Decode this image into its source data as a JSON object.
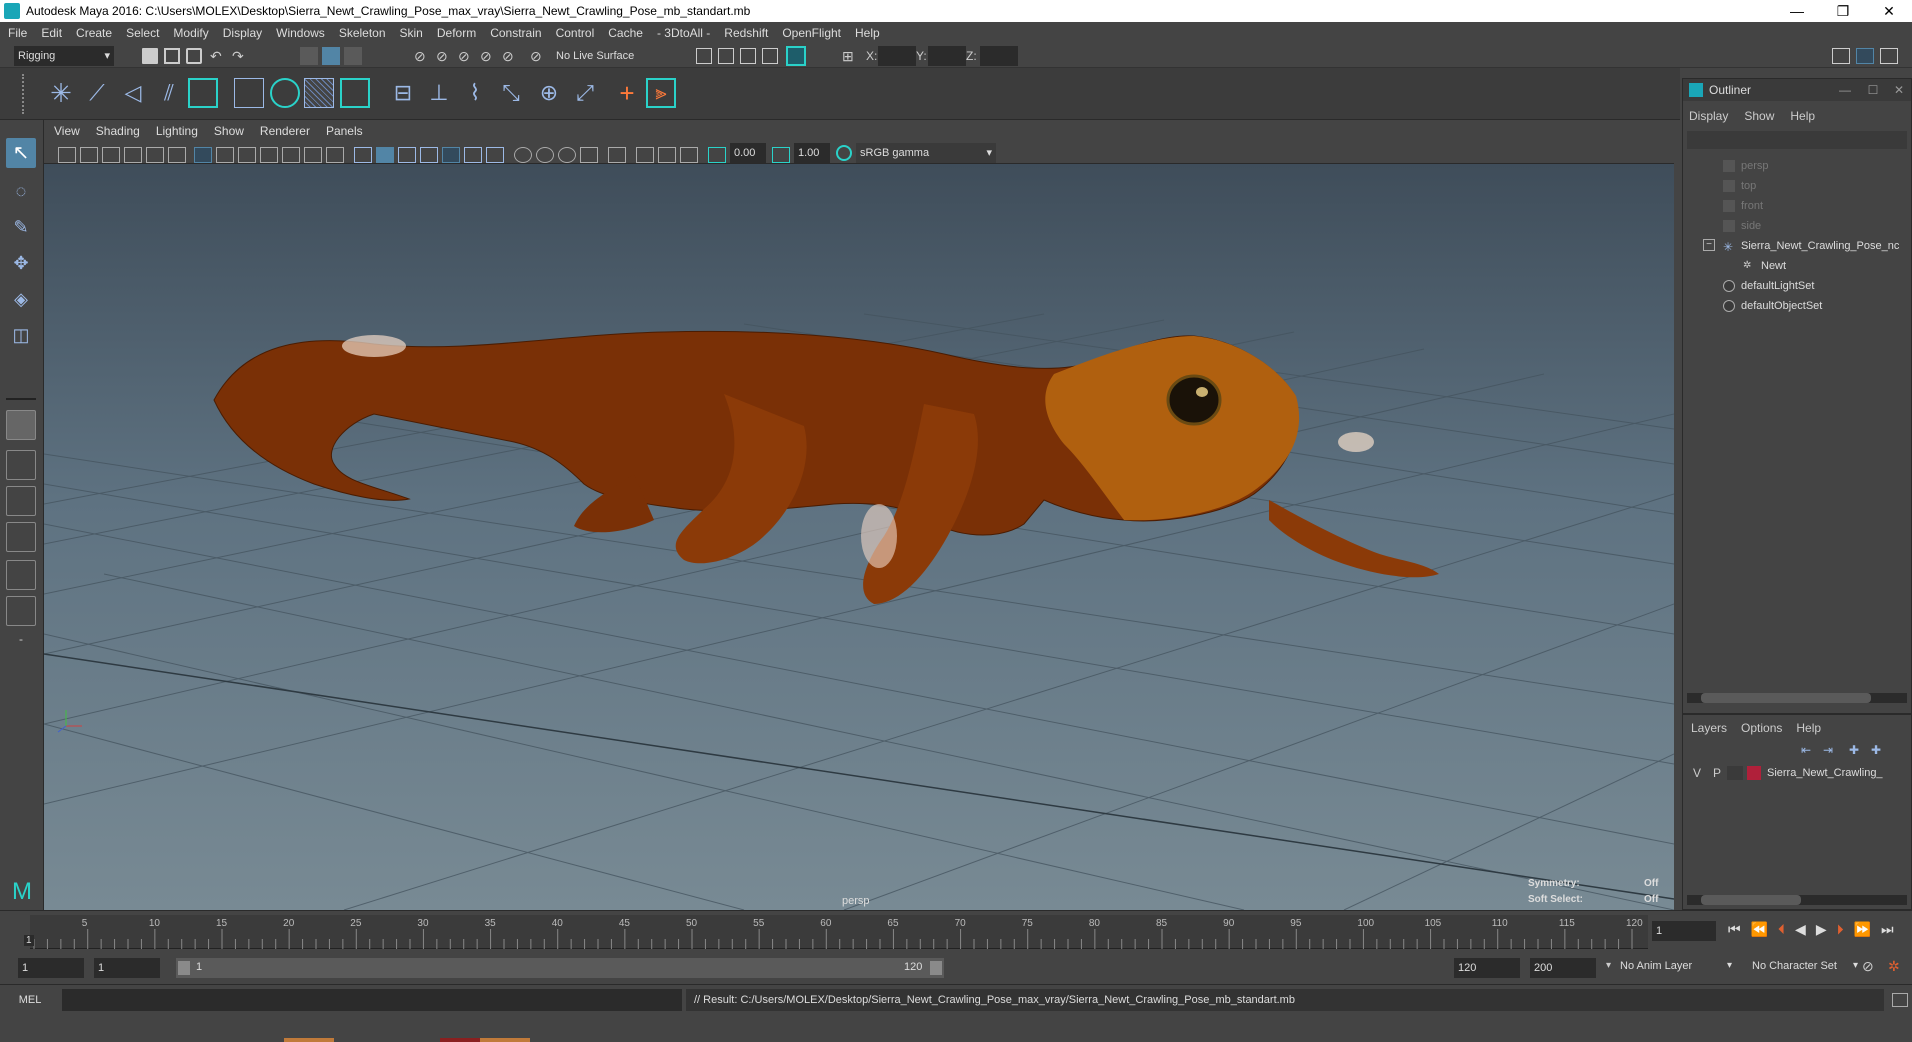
{
  "window": {
    "title": "Autodesk Maya 2016: C:\\Users\\MOLEX\\Desktop\\Sierra_Newt_Crawling_Pose_max_vray\\Sierra_Newt_Crawling_Pose_mb_standart.mb",
    "controls": [
      "—",
      "❐",
      "✕"
    ]
  },
  "menubar": [
    "File",
    "Edit",
    "Create",
    "Select",
    "Modify",
    "Display",
    "Windows",
    "Skeleton",
    "Skin",
    "Deform",
    "Constrain",
    "Control",
    "Cache",
    "- 3DtoAll -",
    "Redshift",
    "OpenFlight",
    "Help"
  ],
  "statusline": {
    "menuset": "Rigging",
    "live_surface": "No Live Surface",
    "x_label": "X:",
    "y_label": "Y:",
    "z_label": "Z:"
  },
  "viewport": {
    "menus": [
      "View",
      "Shading",
      "Lighting",
      "Show",
      "Renderer",
      "Panels"
    ],
    "exposure": "0.00",
    "gamma": "1.00",
    "color_space": "sRGB gamma",
    "camera_label": "persp",
    "symmetry_label": "Symmetry:",
    "symmetry_value": "Off",
    "soft_select_label": "Soft Select:",
    "soft_select_value": "Off"
  },
  "outliner": {
    "title": "Outliner",
    "menus": [
      "Display",
      "Show",
      "Help"
    ],
    "items": [
      {
        "label": "persp",
        "dim": true
      },
      {
        "label": "top",
        "dim": true
      },
      {
        "label": "front",
        "dim": true
      },
      {
        "label": "side",
        "dim": true
      },
      {
        "label": "Sierra_Newt_Crawling_Pose_nc",
        "dim": false
      },
      {
        "label": "Newt",
        "dim": false
      },
      {
        "label": "defaultLightSet",
        "dim": false
      },
      {
        "label": "defaultObjectSet",
        "dim": false
      }
    ]
  },
  "layers": {
    "menus": [
      "Layers",
      "Options",
      "Help"
    ],
    "row": {
      "v": "V",
      "p": "P",
      "name": "Sierra_Newt_Crawling_",
      "color": "#b0203a"
    }
  },
  "timeline": {
    "ticks": [
      "5",
      "10",
      "15",
      "20",
      "25",
      "30",
      "35",
      "40",
      "45",
      "50",
      "55",
      "60",
      "65",
      "70",
      "75",
      "80",
      "85",
      "90",
      "95",
      "100",
      "105",
      "110",
      "115",
      "120"
    ],
    "start_tick": "1",
    "current_frame": "1"
  },
  "rangebar": {
    "start": "1",
    "playback_start": "1",
    "slider_start": "1",
    "slider_end": "120",
    "playback_end": "120",
    "end": "200",
    "anim_layer": "No Anim Layer",
    "char_set": "No Character Set"
  },
  "cmdline": {
    "mode": "MEL",
    "result": "// Result: C:/Users/MOLEX/Desktop/Sierra_Newt_Crawling_Pose_max_vray/Sierra_Newt_Crawling_Pose_mb_standart.mb"
  },
  "colors": {
    "accent": "#1aa6b7",
    "newt_body": "#8a3a06",
    "newt_head": "#b0600f"
  }
}
